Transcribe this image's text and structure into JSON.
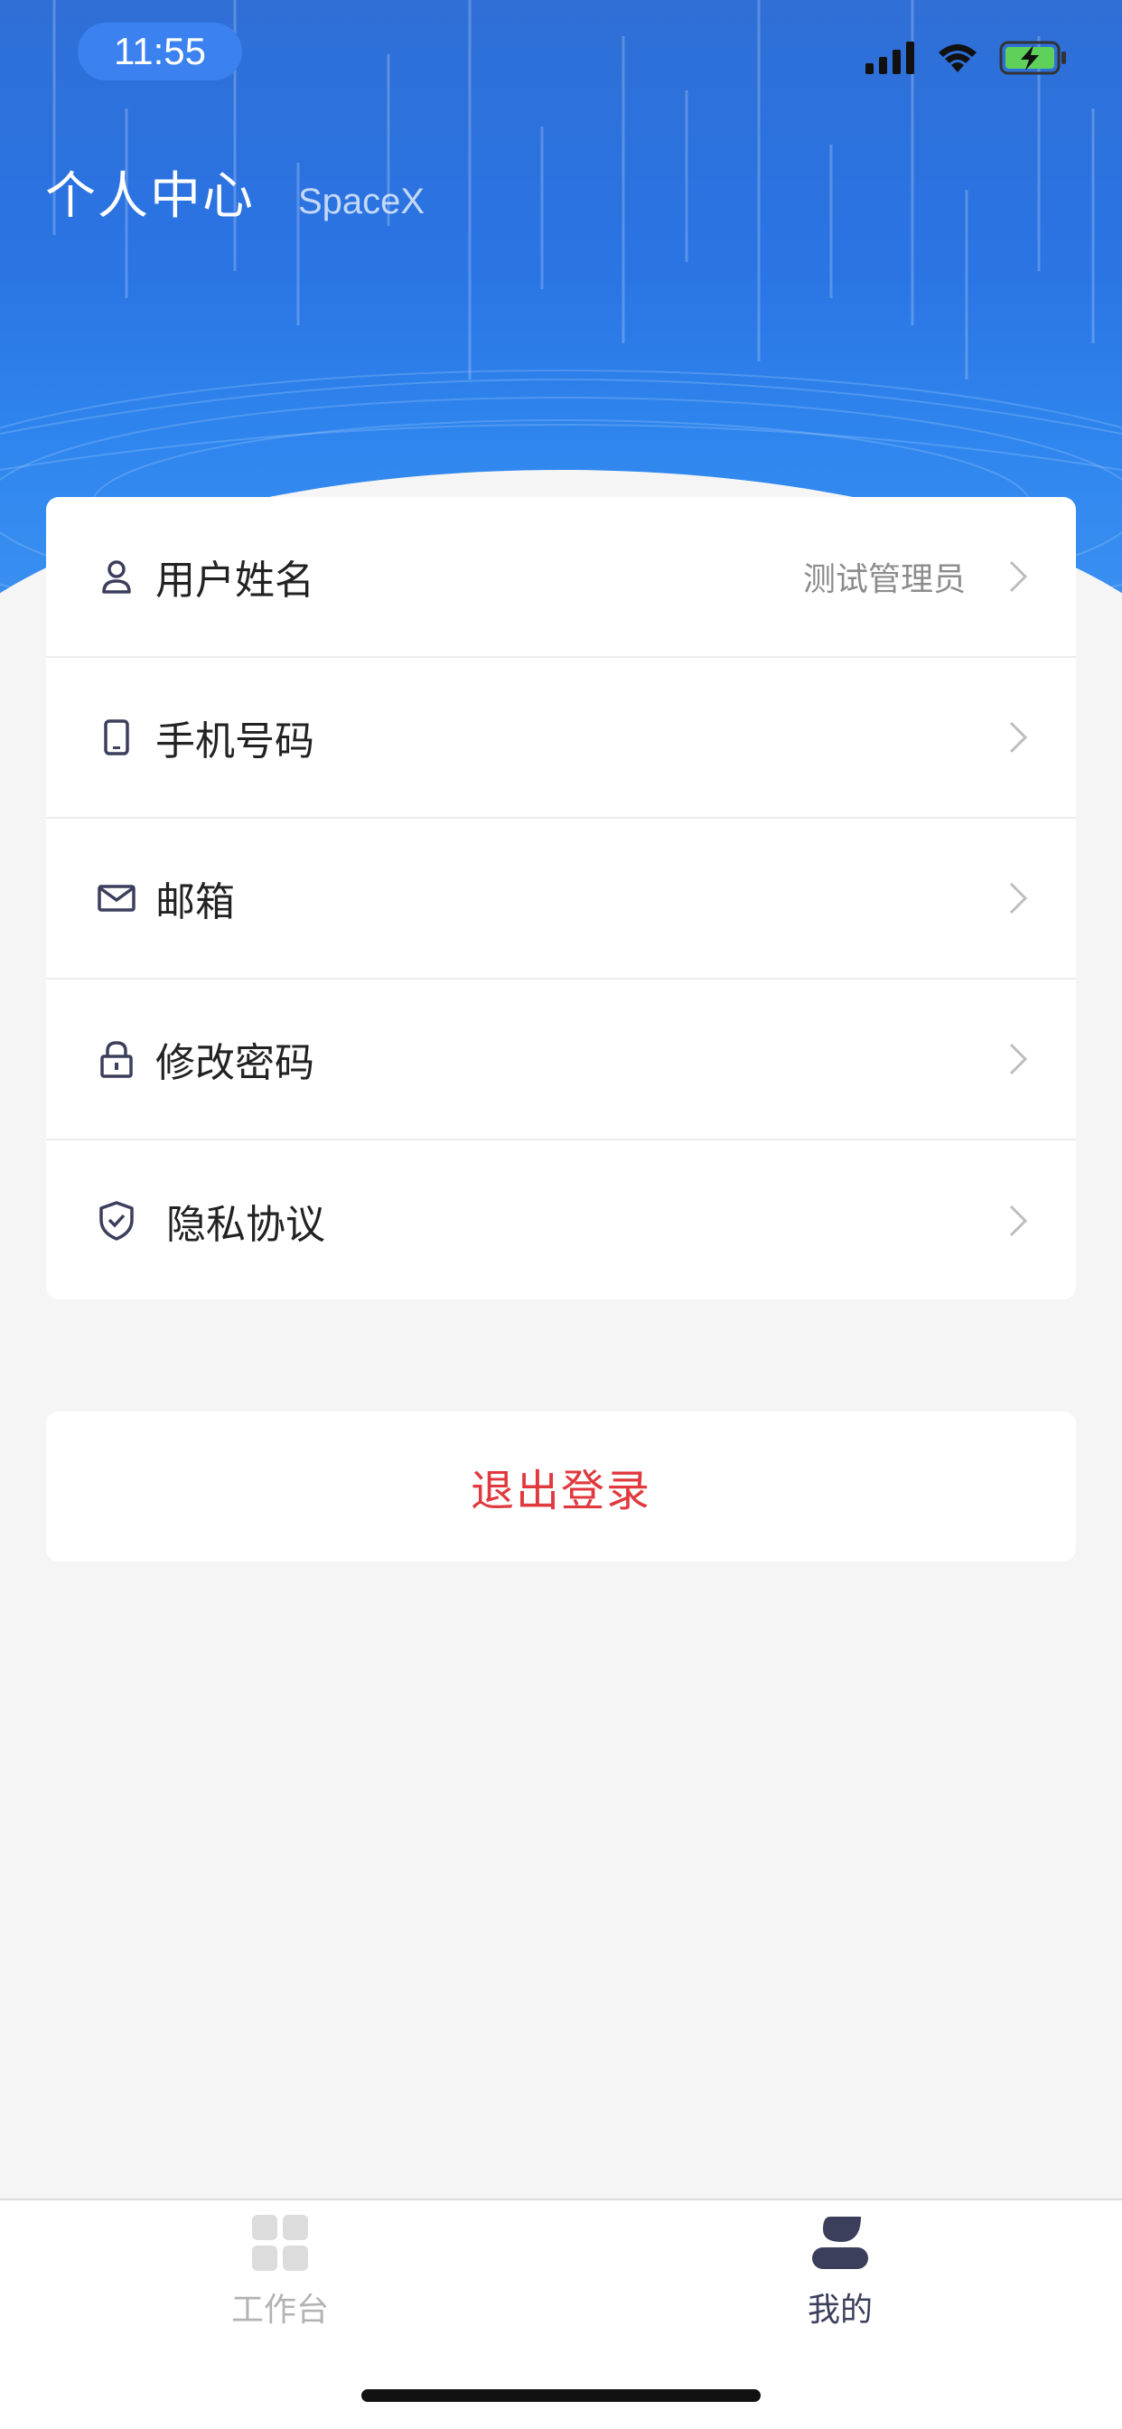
{
  "status_bar": {
    "time": "11:55"
  },
  "header": {
    "title": "个人中心",
    "subtitle": "SpaceX"
  },
  "menu": {
    "items": [
      {
        "icon": "user-icon",
        "label": "用户姓名",
        "value": "测试管理员"
      },
      {
        "icon": "phone-icon",
        "label": "手机号码",
        "value": ""
      },
      {
        "icon": "mail-icon",
        "label": "邮箱",
        "value": ""
      },
      {
        "icon": "lock-icon",
        "label": "修改密码",
        "value": ""
      },
      {
        "icon": "shield-check-icon",
        "label": "隐私协议",
        "value": ""
      }
    ]
  },
  "logout": {
    "label": "退出登录",
    "color": "#e0393e"
  },
  "tabbar": {
    "tabs": [
      {
        "icon": "grid-icon",
        "label": "工作台",
        "active": false
      },
      {
        "icon": "profile-icon",
        "label": "我的",
        "active": true
      }
    ]
  },
  "colors": {
    "header_blue": "#2a74e4",
    "accent_dark": "#3b3f5c",
    "danger": "#e0393e"
  }
}
